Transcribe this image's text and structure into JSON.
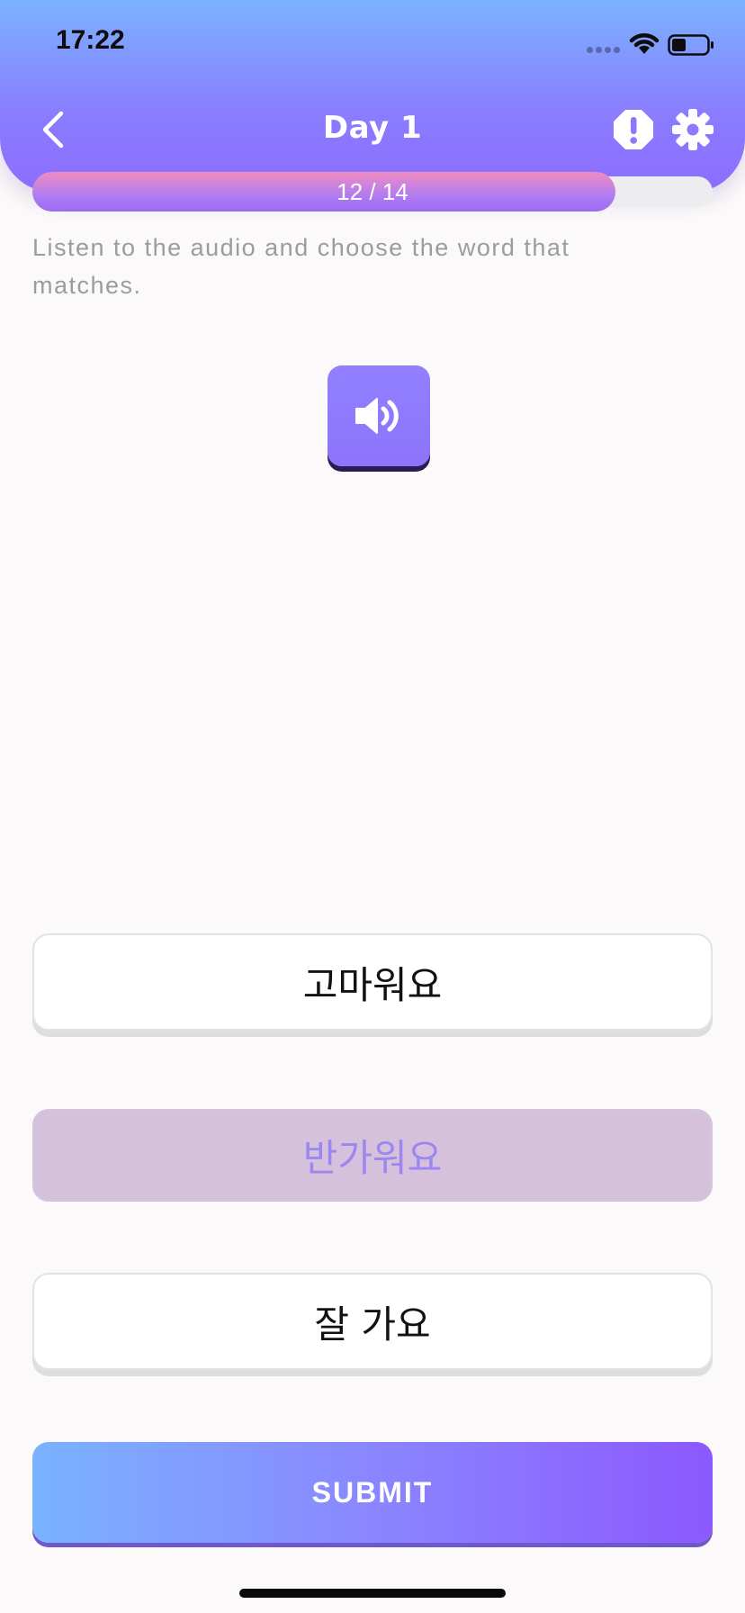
{
  "status_bar": {
    "time": "17:22"
  },
  "header": {
    "title": "Day 1"
  },
  "progress": {
    "current": 12,
    "total": 14,
    "label": "12 / 14",
    "fraction": 0.857
  },
  "instruction": "Listen to the audio and choose the word that matches.",
  "options": [
    {
      "label": "고마워요",
      "selected": false
    },
    {
      "label": "반가워요",
      "selected": true
    },
    {
      "label": "잘 가요",
      "selected": false
    }
  ],
  "submit_label": "SUBMIT",
  "colors": {
    "header_top": "#7ab2ff",
    "header_bottom": "#8d6dff",
    "accent": "#8c74fb",
    "selected_option_bg": "#d6c1dc",
    "selected_option_text": "#9b87f0"
  },
  "icons": {
    "back": "chevron-left-icon",
    "report": "alert-octagon-icon",
    "settings": "gear-icon",
    "audio": "speaker-volume-icon"
  }
}
